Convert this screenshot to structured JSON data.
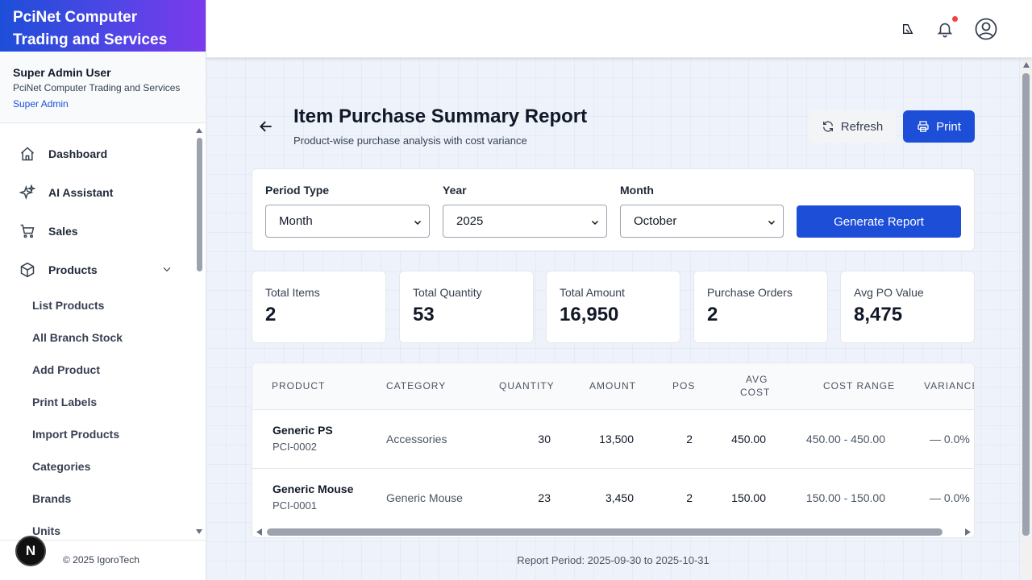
{
  "brand": {
    "line1": "PciNet Computer",
    "line2": "Trading and Services"
  },
  "user": {
    "name": "Super Admin User",
    "company": "PciNet Computer Trading and Services",
    "role": "Super Admin"
  },
  "nav": {
    "items": [
      {
        "label": "Dashboard",
        "icon": "home-icon"
      },
      {
        "label": "AI Assistant",
        "icon": "sparkles-icon"
      },
      {
        "label": "Sales",
        "icon": "cart-icon"
      },
      {
        "label": "Products",
        "icon": "box-icon"
      }
    ],
    "sub_items": [
      "List Products",
      "All Branch Stock",
      "Add Product",
      "Print Labels",
      "Import Products",
      "Categories",
      "Brands",
      "Units"
    ]
  },
  "footer": {
    "badge": "N",
    "copyright": "© 2025 IgoroTech"
  },
  "page": {
    "title": "Item Purchase Summary Report",
    "subtitle": "Product-wise purchase analysis with cost variance",
    "refresh_label": "Refresh",
    "print_label": "Print"
  },
  "filters": {
    "period_type": {
      "label": "Period Type",
      "value": "Month"
    },
    "year": {
      "label": "Year",
      "value": "2025"
    },
    "month": {
      "label": "Month",
      "value": "October"
    },
    "generate_label": "Generate Report"
  },
  "stats": [
    {
      "label": "Total Items",
      "value": "2"
    },
    {
      "label": "Total Quantity",
      "value": "53"
    },
    {
      "label": "Total Amount",
      "value": "16,950"
    },
    {
      "label": "Purchase Orders",
      "value": "2"
    },
    {
      "label": "Avg PO Value",
      "value": "8,475"
    }
  ],
  "table": {
    "headers": {
      "product": "PRODUCT",
      "category": "CATEGORY",
      "quantity": "QUANTITY",
      "amount": "AMOUNT",
      "pos": "POS",
      "avg_cost_1": "AVG",
      "avg_cost_2": "COST",
      "cost_range": "COST RANGE",
      "variance": "VARIANCE"
    },
    "rows": [
      {
        "name": "Generic PS",
        "code": "PCI-0002",
        "category": "Accessories",
        "quantity": "30",
        "amount": "13,500",
        "pos": "2",
        "avg_cost": "450.00",
        "cost_range": "450.00 - 450.00",
        "variance": "— 0.0%"
      },
      {
        "name": "Generic Mouse",
        "code": "PCI-0001",
        "category": "Generic Mouse",
        "quantity": "23",
        "amount": "3,450",
        "pos": "2",
        "avg_cost": "150.00",
        "cost_range": "150.00 - 150.00",
        "variance": "— 0.0%"
      }
    ]
  },
  "report_period": "Report Period: 2025-09-30 to 2025-10-31"
}
